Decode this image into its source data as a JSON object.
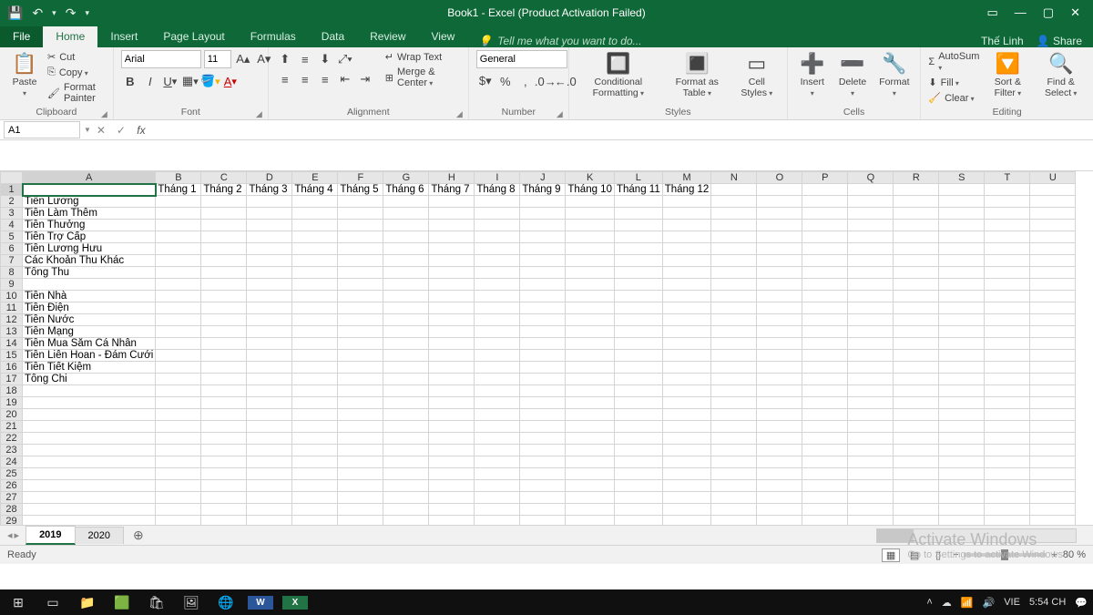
{
  "title": "Book1 - Excel (Product Activation Failed)",
  "qat": {
    "save": "💾",
    "undo": "↶",
    "redo": "↷"
  },
  "winctrl": {
    "opts": "▭",
    "min": "—",
    "max": "▢",
    "close": "✕"
  },
  "tabs": [
    "File",
    "Home",
    "Insert",
    "Page Layout",
    "Formulas",
    "Data",
    "Review",
    "View"
  ],
  "active_tab": "Home",
  "tellme": "Tell me what you want to do...",
  "user": "Thế Linh",
  "share": "Share",
  "ribbon": {
    "clipboard": {
      "paste": "Paste",
      "cut": "Cut",
      "copy": "Copy",
      "fmt": "Format Painter",
      "label": "Clipboard"
    },
    "font": {
      "name": "Arial",
      "size": "11",
      "label": "Font"
    },
    "alignment": {
      "wrap": "Wrap Text",
      "merge": "Merge & Center",
      "label": "Alignment"
    },
    "number": {
      "fmt": "General",
      "label": "Number"
    },
    "styles": {
      "cond": "Conditional Formatting",
      "fas": "Format as Table",
      "cell": "Cell Styles",
      "label": "Styles"
    },
    "cells": {
      "ins": "Insert",
      "del": "Delete",
      "fmt": "Format",
      "label": "Cells"
    },
    "editing": {
      "sum": "AutoSum",
      "fill": "Fill",
      "clear": "Clear",
      "sort": "Sort & Filter",
      "find": "Find & Select",
      "label": "Editing"
    }
  },
  "namebox": "A1",
  "columns": [
    "A",
    "B",
    "C",
    "D",
    "E",
    "F",
    "G",
    "H",
    "I",
    "J",
    "K",
    "L",
    "M",
    "N",
    "O",
    "P",
    "Q",
    "R",
    "S",
    "T",
    "U"
  ],
  "row_count": 29,
  "header_row": [
    "",
    "Tháng 1",
    "Tháng 2",
    "Tháng 3",
    "Tháng 4",
    "Tháng 5",
    "Tháng 6",
    "Tháng 7",
    "Tháng 8",
    "Tháng 9",
    "Tháng 10",
    "Tháng 11",
    "Tháng 12"
  ],
  "colA": {
    "2": "Tiền Lương",
    "3": "Tiền Làm Thêm",
    "4": "Tiền Thưởng",
    "5": "Tiền Trợ Cấp",
    "6": "Tiền Lương Hưu",
    "7": "Các Khoản Thu Khác",
    "8": "Tổng Thu",
    "10": "Tiền Nhà",
    "11": "Tiền Điện",
    "12": "Tiền Nước",
    "13": "Tiền Mạng",
    "14": "Tiền Mua Sắm Cá Nhân",
    "15": "Tiền Liên Hoan - Đám Cưới",
    "16": "Tiền Tiết Kiệm",
    "17": "Tổng Chi"
  },
  "sheets": [
    "2019",
    "2020"
  ],
  "active_sheet": "2019",
  "status": "Ready",
  "zoom": "80 %",
  "watermark": {
    "line1": "Activate Windows",
    "line2": "Go to Settings to activate Windows."
  },
  "tray": {
    "lang": "VIE",
    "time": "5:54 CH"
  }
}
